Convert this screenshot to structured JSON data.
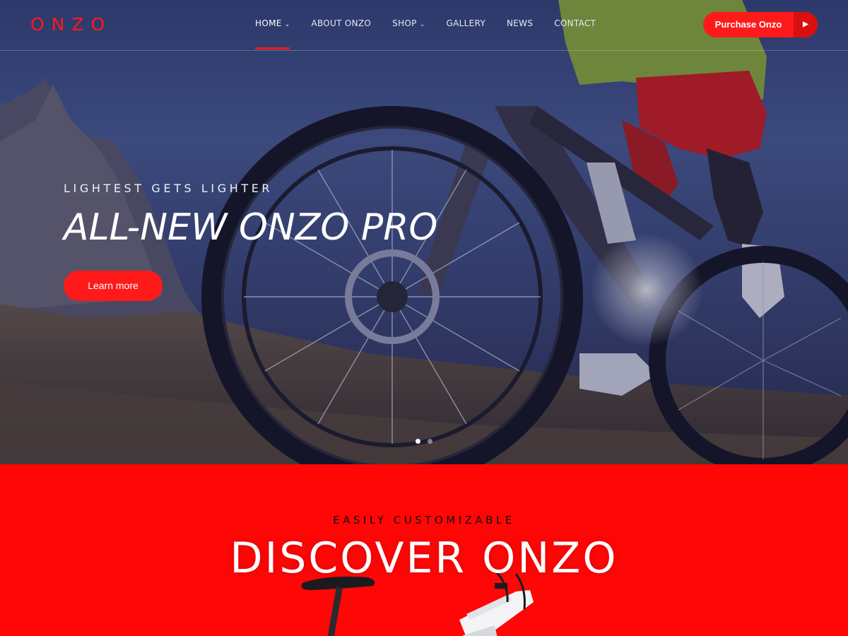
{
  "brand": {
    "logo_text": "ONZO",
    "accent_color": "#ff1a1a"
  },
  "nav": {
    "items": [
      {
        "label": "HOME",
        "has_dropdown": true,
        "active": true
      },
      {
        "label": "ABOUT ONZO",
        "has_dropdown": false
      },
      {
        "label": "SHOP",
        "has_dropdown": true
      },
      {
        "label": "GALLERY",
        "has_dropdown": false
      },
      {
        "label": "NEWS",
        "has_dropdown": false
      },
      {
        "label": "CONTACT",
        "has_dropdown": false
      }
    ],
    "dropdown_icon": "chevron-down-icon"
  },
  "header": {
    "purchase_label": "Purchase Onzo",
    "purchase_icon": "caret-right-icon"
  },
  "hero": {
    "eyebrow": "LIGHTEST GETS LIGHTER",
    "title": "ALL-NEW ONZO PRO",
    "cta_label": "Learn more",
    "slides_total": 2,
    "active_slide": 1,
    "image": "mountain bike rider on a mountain trail"
  },
  "section_discover": {
    "eyebrow": "EASILY CUSTOMIZABLE",
    "title": "DISCOVER ONZO",
    "background_color": "#ff0707"
  }
}
